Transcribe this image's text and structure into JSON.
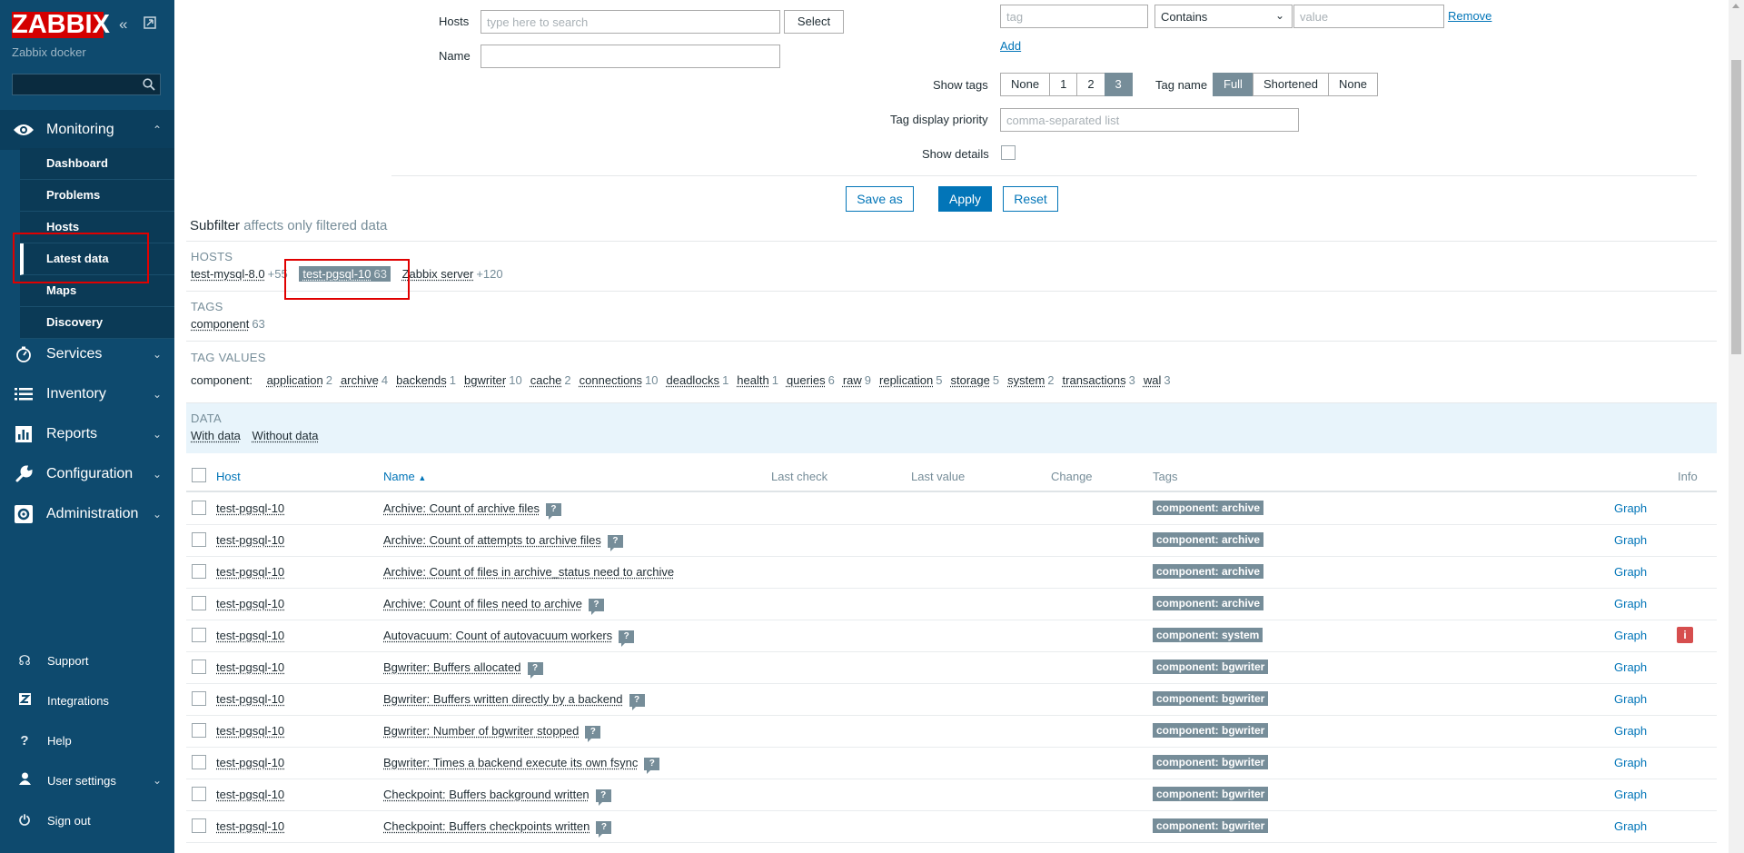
{
  "sidebar": {
    "logo": "ZABBIX",
    "server_name": "Zabbix docker",
    "search_value": "",
    "monitoring": {
      "label": "Monitoring",
      "items": [
        "Dashboard",
        "Problems",
        "Hosts",
        "Latest data",
        "Maps",
        "Discovery"
      ]
    },
    "groups": [
      "Services",
      "Inventory",
      "Reports",
      "Configuration",
      "Administration"
    ],
    "bottom": [
      "Support",
      "Integrations",
      "Help",
      "User settings",
      "Sign out"
    ]
  },
  "filter": {
    "hosts_label": "Hosts",
    "hosts_placeholder": "type here to search",
    "select_button": "Select",
    "name_label": "Name",
    "name_value": "",
    "tag_placeholder": "tag",
    "operator_value": "Contains",
    "value_placeholder": "value",
    "remove_link": "Remove",
    "add_link": "Add",
    "show_tags_label": "Show tags",
    "show_tags_options": [
      "None",
      "1",
      "2",
      "3"
    ],
    "show_tags_selected": "3",
    "tag_name_label": "Tag name",
    "tag_name_options": [
      "Full",
      "Shortened",
      "None"
    ],
    "tag_name_selected": "Full",
    "tag_priority_label": "Tag display priority",
    "tag_priority_placeholder": "comma-separated list",
    "show_details_label": "Show details",
    "save_as": "Save as",
    "apply": "Apply",
    "reset": "Reset"
  },
  "subfilter": {
    "title": "Subfilter",
    "subtitle": "affects only filtered data",
    "hosts_heading": "HOSTS",
    "hosts": [
      {
        "name": "test-mysql-8.0",
        "count": "+55"
      },
      {
        "name": "test-pgsql-10",
        "count": "63"
      },
      {
        "name": "Zabbix server",
        "count": "+120"
      }
    ],
    "tags_heading": "TAGS",
    "tags": [
      {
        "name": "component",
        "count": "63"
      }
    ],
    "tag_values_heading": "TAG VALUES",
    "tag_values_prefix": "component:",
    "tag_values": [
      {
        "name": "application",
        "count": "2"
      },
      {
        "name": "archive",
        "count": "4"
      },
      {
        "name": "backends",
        "count": "1"
      },
      {
        "name": "bgwriter",
        "count": "10"
      },
      {
        "name": "cache",
        "count": "2"
      },
      {
        "name": "connections",
        "count": "10"
      },
      {
        "name": "deadlocks",
        "count": "1"
      },
      {
        "name": "health",
        "count": "1"
      },
      {
        "name": "queries",
        "count": "6"
      },
      {
        "name": "raw",
        "count": "9"
      },
      {
        "name": "replication",
        "count": "5"
      },
      {
        "name": "storage",
        "count": "5"
      },
      {
        "name": "system",
        "count": "2"
      },
      {
        "name": "transactions",
        "count": "3"
      },
      {
        "name": "wal",
        "count": "3"
      }
    ],
    "data_heading": "DATA",
    "data_options": [
      "With data",
      "Without data"
    ]
  },
  "table": {
    "headers": {
      "host": "Host",
      "name": "Name",
      "last_check": "Last check",
      "last_value": "Last value",
      "change": "Change",
      "tags": "Tags",
      "info": "Info"
    },
    "graph_label": "Graph",
    "rows": [
      {
        "host": "test-pgsql-10",
        "name": "Archive: Count of archive files",
        "help": true,
        "tag": "component: archive",
        "info": false
      },
      {
        "host": "test-pgsql-10",
        "name": "Archive: Count of attempts to archive files",
        "help": true,
        "tag": "component: archive",
        "info": false
      },
      {
        "host": "test-pgsql-10",
        "name": "Archive: Count of files in archive_status need to archive",
        "help": false,
        "tag": "component: archive",
        "info": false
      },
      {
        "host": "test-pgsql-10",
        "name": "Archive: Count of files need to archive",
        "help": true,
        "tag": "component: archive",
        "info": false
      },
      {
        "host": "test-pgsql-10",
        "name": "Autovacuum: Count of autovacuum workers",
        "help": true,
        "tag": "component: system",
        "info": true
      },
      {
        "host": "test-pgsql-10",
        "name": "Bgwriter: Buffers allocated",
        "help": true,
        "tag": "component: bgwriter",
        "info": false
      },
      {
        "host": "test-pgsql-10",
        "name": "Bgwriter: Buffers written directly by a backend",
        "help": true,
        "tag": "component: bgwriter",
        "info": false
      },
      {
        "host": "test-pgsql-10",
        "name": "Bgwriter: Number of bgwriter stopped",
        "help": true,
        "tag": "component: bgwriter",
        "info": false
      },
      {
        "host": "test-pgsql-10",
        "name": "Bgwriter: Times a backend execute its own fsync",
        "help": true,
        "tag": "component: bgwriter",
        "info": false
      },
      {
        "host": "test-pgsql-10",
        "name": "Checkpoint: Buffers background written",
        "help": true,
        "tag": "component: bgwriter",
        "info": false
      },
      {
        "host": "test-pgsql-10",
        "name": "Checkpoint: Buffers checkpoints written",
        "help": true,
        "tag": "component: bgwriter",
        "info": false
      }
    ]
  },
  "colors": {
    "sidebar": "#0e4a6e",
    "accent": "#0275b8",
    "tag": "#768d99",
    "highlight": "#e00000"
  }
}
